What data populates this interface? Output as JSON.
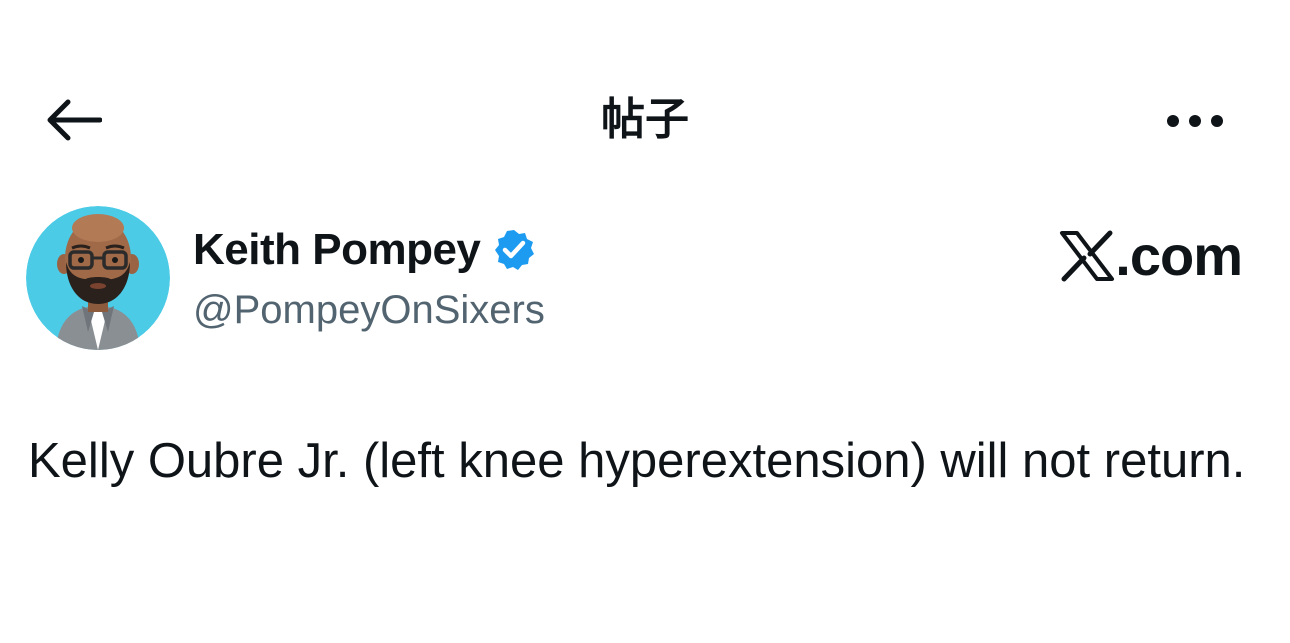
{
  "header": {
    "title": "帖子",
    "back_icon": "arrow-left-icon",
    "more_icon": "more-horizontal-icon"
  },
  "author": {
    "name": "Keith Pompey",
    "handle": "@PompeyOnSixers",
    "verified": true,
    "verified_icon": "verified-badge-icon",
    "avatar_icon": "avatar-memoji"
  },
  "source": {
    "logo_icon": "x-logo-icon",
    "label": ".com"
  },
  "post": {
    "text": "Kelly Oubre Jr. (left knee hyperextension) will not return."
  },
  "colors": {
    "text_primary": "#0f1419",
    "text_secondary": "#536471",
    "verified_blue": "#1d9bf0",
    "avatar_bg": "#4ccbe6"
  }
}
